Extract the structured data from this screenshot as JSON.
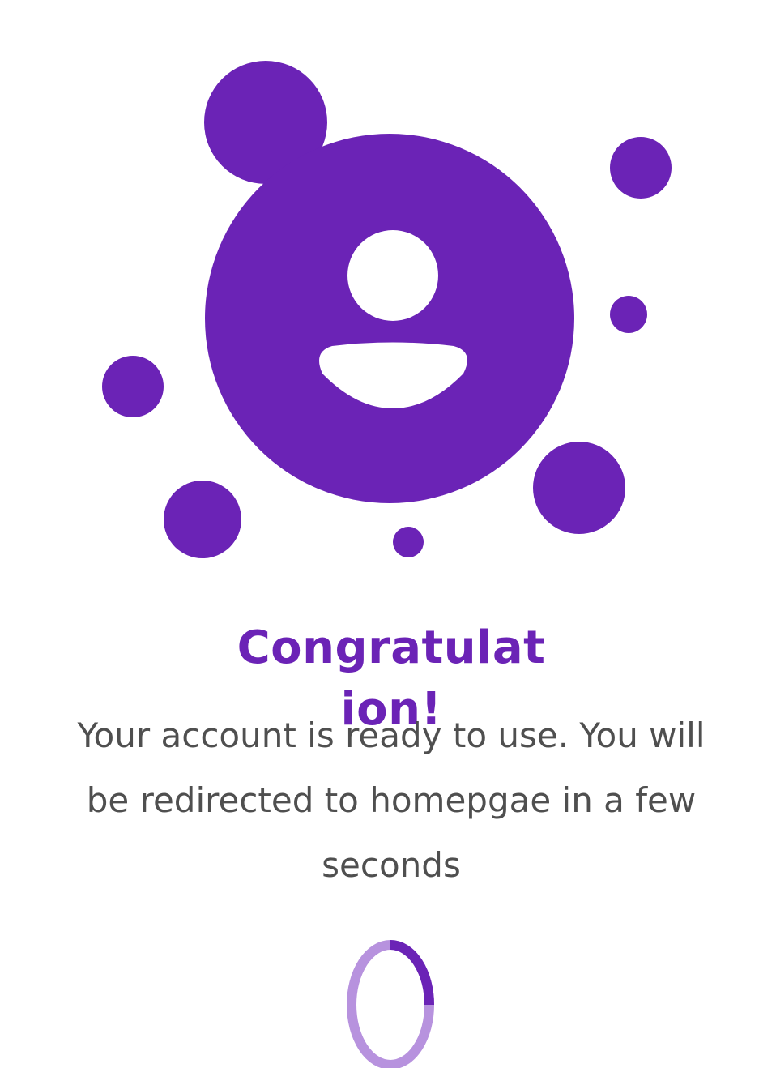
{
  "colors": {
    "accent": "#6b23b6",
    "loader_track": "#b792de",
    "text_body": "#4f4f4f",
    "background": "#ffffff"
  },
  "illustration": {
    "icon": "user-profile-icon"
  },
  "success": {
    "title": "Congratulation!",
    "message": "Your account is ready to use. You will be redirected to homepgae in a few seconds"
  },
  "loader": {
    "icon": "loading-spinner-icon",
    "progress": 0.25
  }
}
